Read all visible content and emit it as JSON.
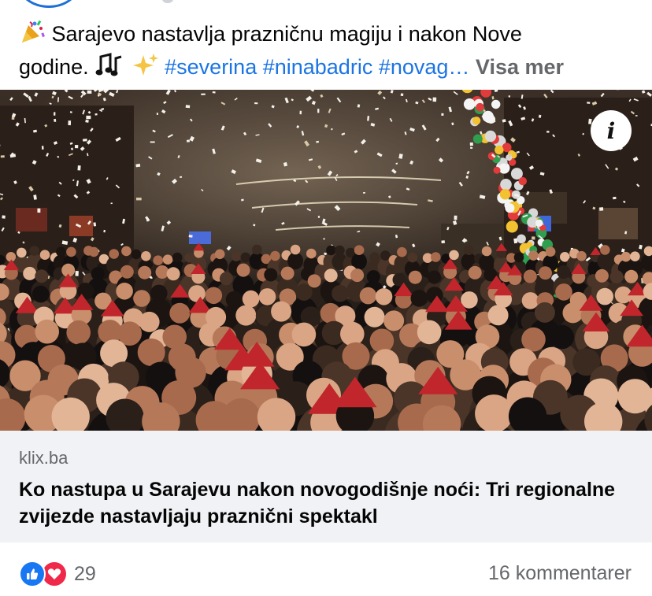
{
  "post": {
    "text_line1": "Sarajevo nastavlja prazničnu magiju i nakon Nove",
    "text_line2_start": "godine.",
    "hashtags": "#severina #ninabadric #novag…",
    "see_more": "Visa mer",
    "icons": [
      "party-popper-emoji",
      "musical-notes-emoji",
      "sparkles-emoji"
    ]
  },
  "link_preview": {
    "domain": "klix.ba",
    "headline": "Ko nastupa u Sarajevu nakon novogodišnje noći: Tri regionalne zvijezde nastavljaju praznični spektakl",
    "info_label": "i"
  },
  "footer": {
    "reaction_count": "29",
    "comments": "16 kommentarer",
    "reaction_icons": [
      "like-icon",
      "love-icon"
    ]
  },
  "colors": {
    "hashtag": "#1b74e4",
    "secondary_text": "#65676b",
    "like": "#1877f2",
    "love": "#f0284a",
    "link_box_bg": "#f0f2f5"
  }
}
